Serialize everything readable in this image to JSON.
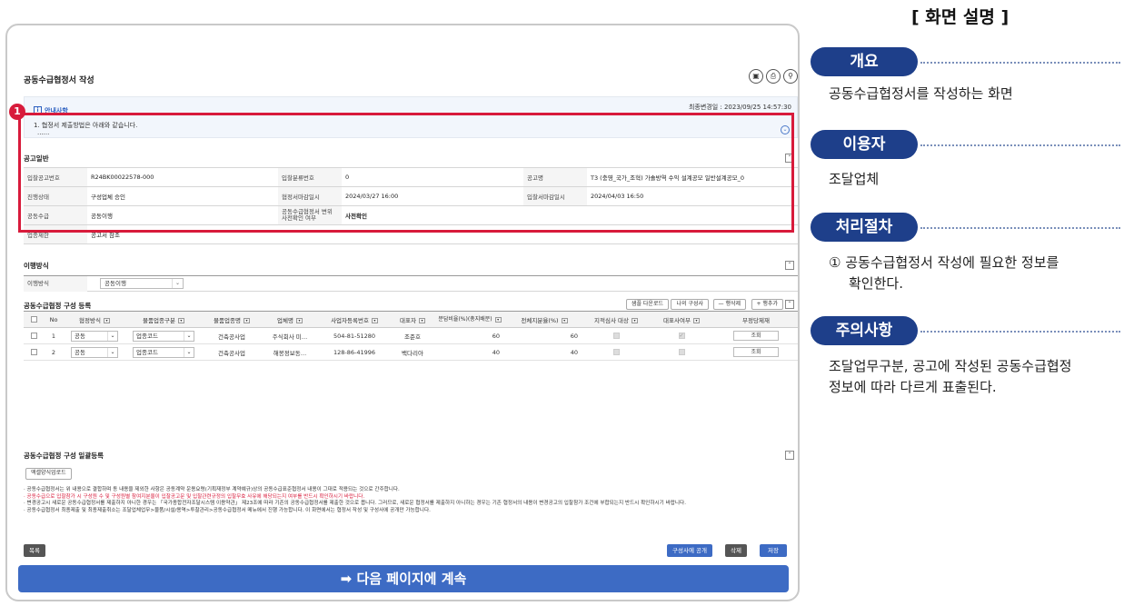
{
  "screen": {
    "page_title": "공동수급협정서 작성",
    "top_icons": [
      "save-icon",
      "print-icon",
      "zoom-icon"
    ],
    "info": {
      "title": "안내사항",
      "line1": "1. 협정서 제출방법은 아래와 같습니다.",
      "dots": "......",
      "modified": "최종변경일 : 2023/09/25 14:57:30"
    },
    "notice": {
      "title": "공고일반",
      "rows": [
        [
          {
            "label": "입찰공고번호",
            "value": "R24BK00022578-000"
          },
          {
            "label": "입찰분류번호",
            "value": "0"
          },
          {
            "label": "공고명",
            "value": "T3 (충영_국가_조혁) 가솔방역 수익 설계공모 일반설계공모_0"
          }
        ],
        [
          {
            "label": "진행상태",
            "value": "구성업체 승인"
          },
          {
            "label": "협정서마감일시",
            "value": "2024/03/27 16:00"
          },
          {
            "label": "입찰서마감일시",
            "value": "2024/04/03 16:50"
          }
        ],
        [
          {
            "label": "공동수급",
            "value": "공동이행"
          },
          {
            "label": "공동수급협정서 변위 사전확인 여부",
            "value": "사전확인"
          },
          {
            "label": "",
            "value": ""
          }
        ],
        [
          {
            "label": "업종제한",
            "value": "공고서 참조"
          }
        ]
      ]
    },
    "method": {
      "title": "이행방식",
      "label": "이행방식",
      "value": "공동이행"
    },
    "members": {
      "title": "공동수급협정 구성 등록",
      "buttons": [
        "샘플 다운로드",
        "나의 구성사",
        "— 행삭제",
        "+ 행추가"
      ],
      "columns": [
        "No",
        "협정방식",
        "물품업종구분",
        "물품업종명",
        "업체명",
        "사업자등록번호",
        "대표자",
        "분담비율(%)(총지배분)",
        "전체지분율(%)",
        "지적심사 대상",
        "대표사여부",
        "부정당제재"
      ],
      "rows": [
        {
          "no": "1",
          "method": "공동",
          "type": "업종코드",
          "industry": "건축공사업",
          "company": "주식회사 미…",
          "biz_no": "504-81-51280",
          "ceo": "조준호",
          "share": "60",
          "total": "60",
          "btn": "조회"
        },
        {
          "no": "2",
          "method": "공동",
          "type": "업종코드",
          "industry": "건축공사업",
          "company": "해봉정보동…",
          "biz_no": "128-86-41996",
          "ceo": "백다리아",
          "share": "40",
          "total": "40",
          "btn": "조회"
        }
      ]
    },
    "bulk": {
      "title": "공동수급협정 구성 일괄등록",
      "button": "액셀양식업로드",
      "notes": [
        "· 공동수급협정서는 위 내용으로 결합하며 동 내용을 제외한 사항은 공동계약 운용요령(기획재정부 계약예규)상의 공동수급표준협정서 내용이 그대로 적용되는 것으로 간주합니다.",
        "· 공동수급으로 입찰참가 시 구성원 수 및 구성원별 참여지분율이 입찰공고문 및 입찰관련규정의 입찰무효 사유에 해당되는지 여부를 반드시 확인하시기 바랍니다.",
        "· 변경공고시 새로운 공동수급협정서를 제출하지 아니한 경우는 「국가종합전자조달시스템 이용약관」 제23조에 따라 기존의 공동수급협정서를 제출한 것으로 봅니다. 그러므로, 새로운 협정서를 제출하지 아니하는 경우는 기존 협정서의 내용이 변경공고의 입찰참가 조건에 부합되는지 반드시 확인하시기 바랍니다.",
        "· 공동수급협정서 최종제출 및 최종제출취소는 조달업체업무>물품/시설/용역>투찰관리>공동수급협정서 메뉴에서 진행 가능합니다. 이 화면에서는 협정서 작성 및 구성사에 공개만 가능합니다."
      ]
    },
    "bottom": {
      "list": "목록",
      "publish": "구성사에 공개",
      "delete": "삭제",
      "save": "저장"
    },
    "continue": "➡ 다음 페이지에 계속",
    "marker": "1"
  },
  "panel": {
    "title": "[ 화면 설명 ]",
    "sections": [
      {
        "label": "개요",
        "text": [
          "공동수급협정서를 작성하는 화면"
        ]
      },
      {
        "label": "이용자",
        "text": [
          "조달업체"
        ]
      },
      {
        "label": "처리절차",
        "text": [
          "① 공동수급협정서 작성에 필요한 정보를",
          "확인한다."
        ]
      },
      {
        "label": "주의사항",
        "text": [
          "조달업무구분, 공고에 작성된 공동수급협정",
          "정보에 따라 다르게 표출된다."
        ]
      }
    ]
  },
  "colors": {
    "highlight": "#d81b3b",
    "pill": "#1e3f8a",
    "primary": "#3d6bc4",
    "dark_button": "#555555"
  }
}
